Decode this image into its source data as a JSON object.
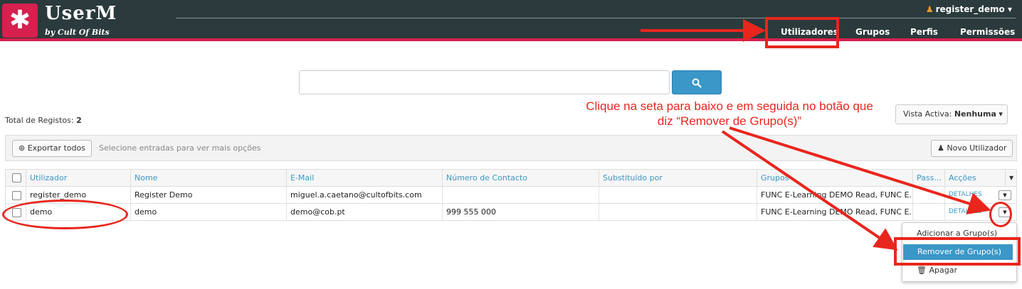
{
  "header": {
    "logo_icon": "asterisk-icon",
    "logo_glyph": "✱",
    "title": "UserM",
    "subtitle": "by Cult Of Bits",
    "user": "register_demo",
    "nav": [
      "Utilizadores",
      "Grupos",
      "Perfis",
      "Permissões"
    ]
  },
  "search": {
    "placeholder": "",
    "button_icon": "search-icon"
  },
  "total": {
    "label": "Total de Registos:",
    "count": "2"
  },
  "vista": {
    "label": "Vista Activa:",
    "value": "Nenhuma"
  },
  "toolbar": {
    "export_label": "Exportar todos",
    "hint": "Selecione entradas para ver mais opções",
    "new_user_label": "Novo Utilizador"
  },
  "table": {
    "columns": [
      "Utilizador",
      "Nome",
      "E-Mail",
      "Número de Contacto",
      "Substituído por",
      "Grupos",
      "Pass...",
      "Acções"
    ],
    "rows": [
      {
        "user": "register_demo",
        "name": "Register Demo",
        "email": "miguel.a.caetano@cultofbits.com",
        "contact": "",
        "replaced": "",
        "groups": "FUNC E-Learning DEMO Read, FUNC E...",
        "pass": "",
        "actions": "DETALHES"
      },
      {
        "user": "demo",
        "name": "demo",
        "email": "demo@cob.pt",
        "contact": "999 555 000",
        "replaced": "",
        "groups": "FUNC E-Learning DEMO Read, FUNC E...",
        "pass": "",
        "actions": "DETALHES"
      }
    ]
  },
  "menu": {
    "add": "Adicionar a Grupo(s)",
    "remove": "Remover de Grupo(s)",
    "delete": "Apagar"
  },
  "annotation": {
    "line1": "Clique na seta para baixo e em seguida no botão que",
    "line2": "diz “Remover de Grupo(s)”",
    "color": "#e8261d"
  },
  "colors": {
    "brand": "#d6204e",
    "header_bg": "#2b3a3c",
    "accent": "#3a97c7"
  }
}
